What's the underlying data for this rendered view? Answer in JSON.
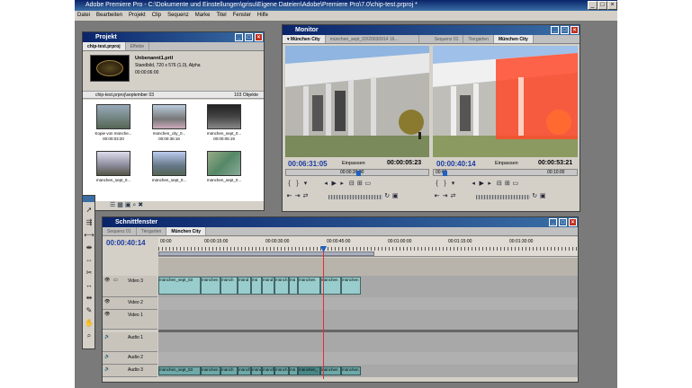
{
  "app": {
    "title": "Adobe Premiere Pro - C:\\Dokumente und Einstellungen\\grisu\\Eigene Dateien\\Adobe\\Premiere Pro\\7.0\\chip-test.prproj *"
  },
  "menu": [
    "Datei",
    "Bearbeiten",
    "Projekt",
    "Clip",
    "Sequenz",
    "Marke",
    "Titel",
    "Fenster",
    "Hilfe"
  ],
  "project": {
    "title": "Projekt",
    "tabs": [
      "chip-test.prproj",
      "Effekte"
    ],
    "preview_name": "Unbenannt1.prtl",
    "preview_info1": "Standbild, 720 x 576 (1,0), Alpha",
    "preview_info2": "00:00:06:00",
    "bin_path": "chip-test.prproj\\september 03",
    "objects": "103 Objekte",
    "clips": [
      {
        "name": "Kopie von münche...",
        "dur": "00:00:03:20"
      },
      {
        "name": "münchen_city_0...",
        "dur": "00:00:36:16"
      },
      {
        "name": "münchen_sept_0...",
        "dur": "00:00:05:19"
      },
      {
        "name": "münchen_sept_0...",
        "dur": ""
      },
      {
        "name": "münchen_sept_0...",
        "dur": ""
      },
      {
        "name": "münchen_sept_0...",
        "dur": ""
      }
    ]
  },
  "monitor": {
    "title": "Monitor",
    "src_tab": "München City",
    "src_file": "münchen_sept_03\\20030914 16...",
    "prog_tabs": [
      "Sequenz 01",
      "Tiergarten",
      "München City"
    ],
    "src_tc": "00:06:31:05",
    "src_fit": "Einpassen",
    "src_dur": "00:00:05:23",
    "prog_tc": "00:00:40:14",
    "prog_fit": "Einpassen",
    "prog_dur": "00:00:53:21",
    "src_ruler": "00:00:30:00",
    "prog_ruler": [
      "00:00",
      "00:10:00"
    ]
  },
  "timeline": {
    "title": "Schnittfenster",
    "tabs": [
      "Sequenz 01",
      "Tiergarten",
      "München City"
    ],
    "timecode": "00:00:40:14",
    "ruler": [
      "00:00",
      "00:00:15:00",
      "00:00:30:00",
      "00:00:45:00",
      "00:01:00:00",
      "00:01:15:00",
      "00:01:30:00"
    ],
    "tracks": [
      "Video 3",
      "Video 2",
      "Video 1",
      "Audio 1",
      "Audio 2",
      "Audio 3"
    ],
    "v3_clips": [
      "münchen_sept_03",
      "münchen",
      "münch",
      "münd",
      "mü",
      "münd",
      "münch",
      "mü",
      "münchen",
      "münchen",
      "münchen"
    ],
    "a3_clips": [
      "münchen_sept_03",
      "münchen",
      "münch",
      "münch",
      "münd",
      "münch",
      "münch",
      "mü",
      "münchen_",
      "münchen",
      "münchen"
    ]
  },
  "colors": {
    "title_blue": "#0a246a",
    "panel": "#d4d0c8",
    "clip_video": "#99cccc",
    "clip_audio": "#6fa8a8",
    "playhead": "#e03030"
  }
}
